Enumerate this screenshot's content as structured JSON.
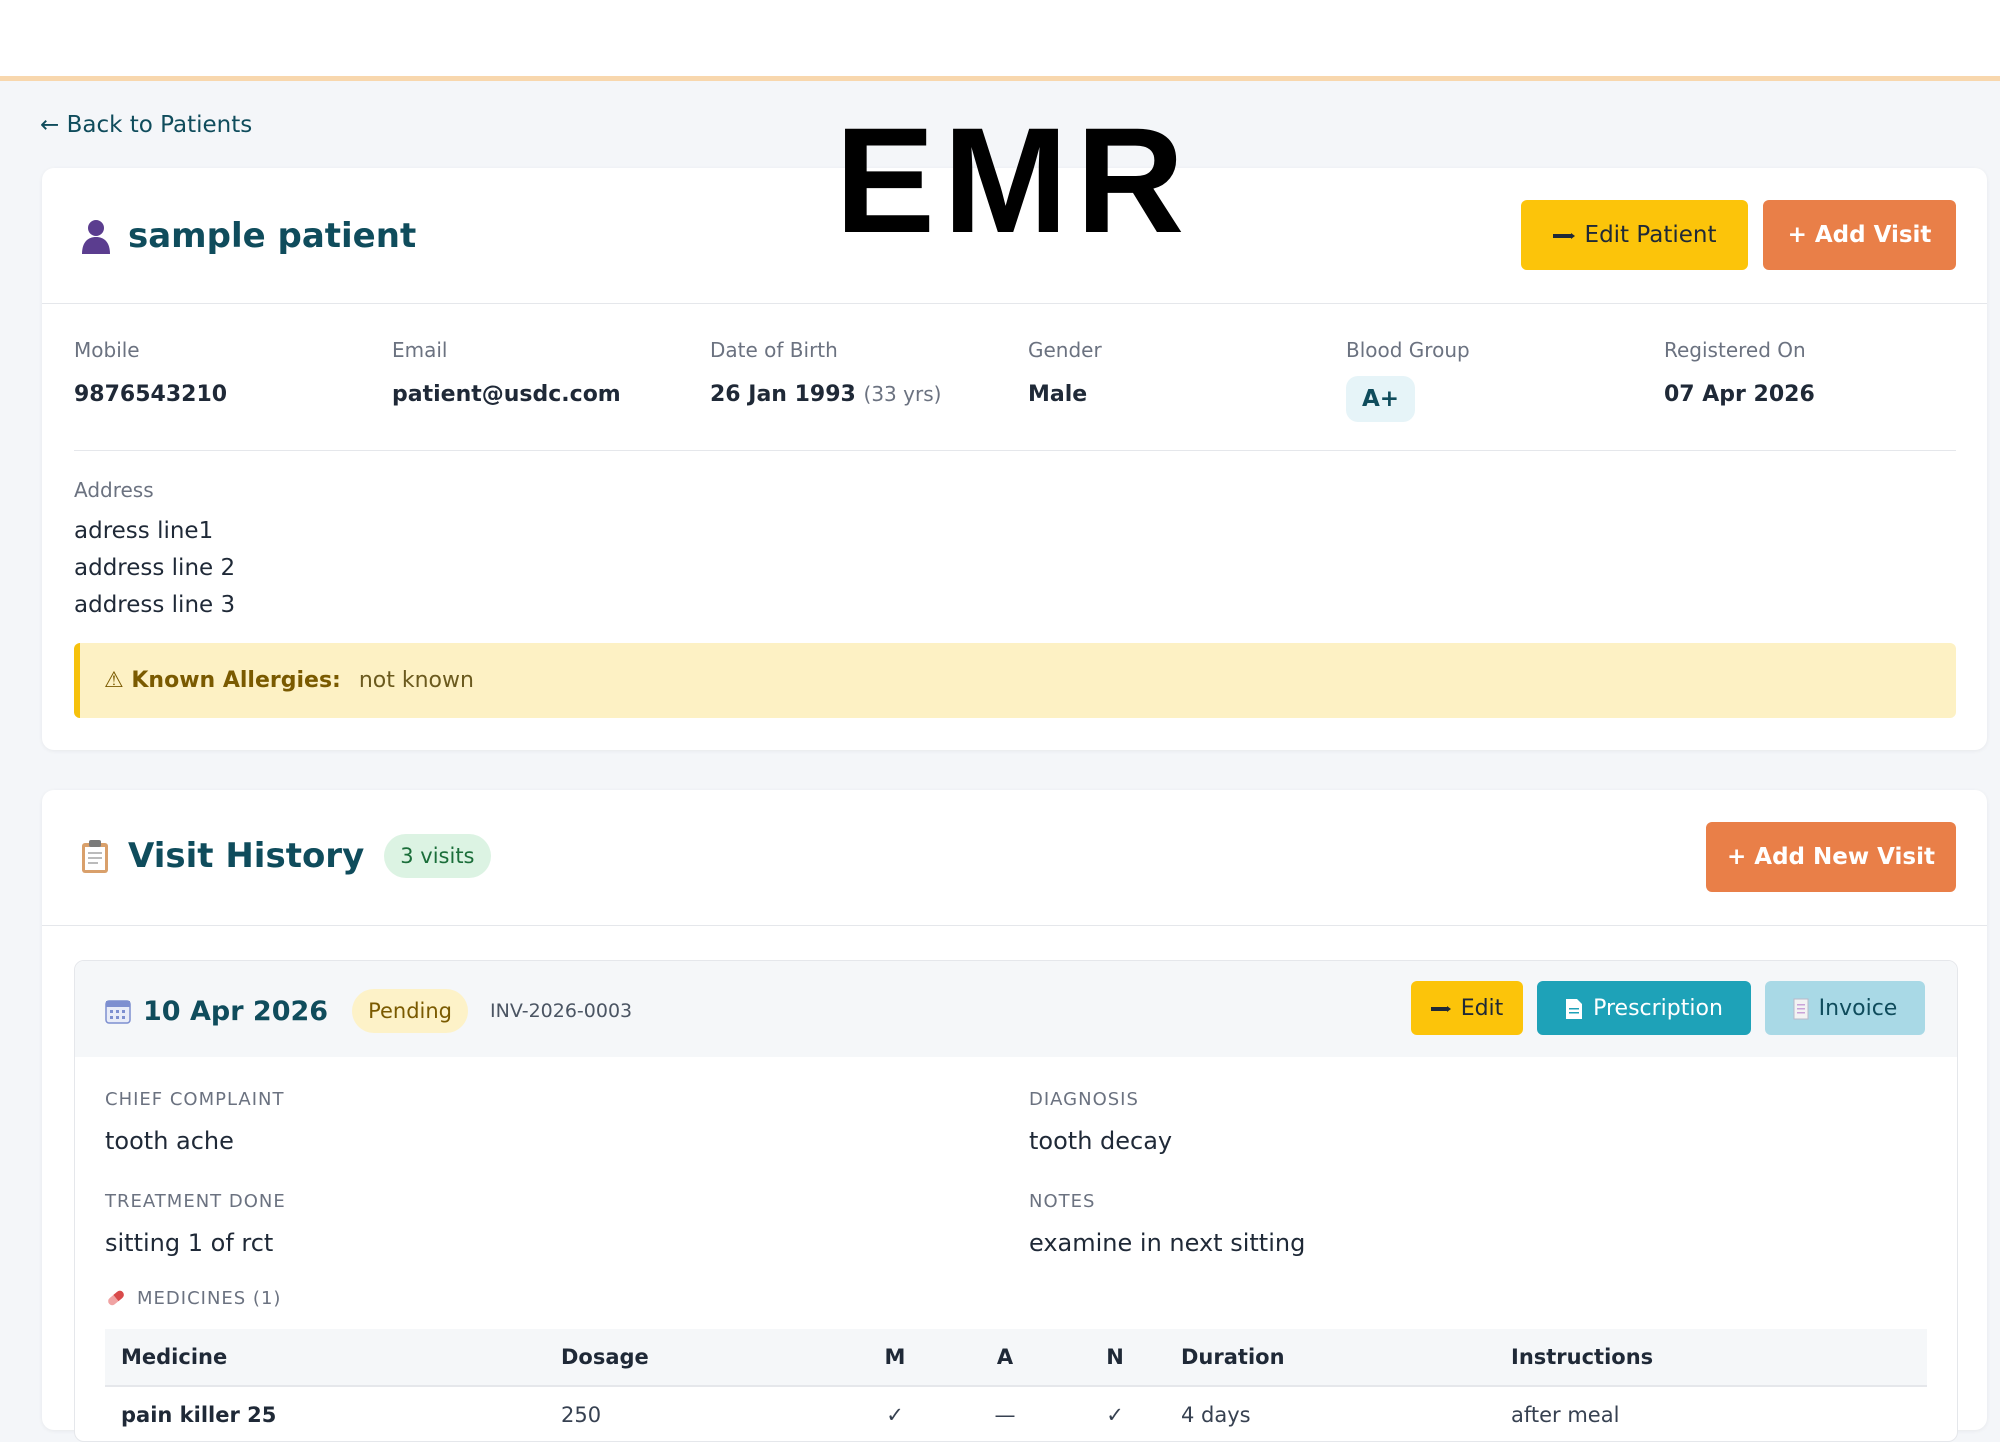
{
  "overlay_text": "EMR",
  "back_link": "← Back to Patients",
  "patient": {
    "name": "sample patient",
    "edit_button": "Edit Patient",
    "add_visit_button": "+ Add Visit",
    "fields": {
      "mobile_label": "Mobile",
      "mobile": "9876543210",
      "email_label": "Email",
      "email": "patient@usdc.com",
      "dob_label": "Date of Birth",
      "dob": "26 Jan 1993",
      "age": "(33 yrs)",
      "gender_label": "Gender",
      "gender": "Male",
      "blood_label": "Blood Group",
      "blood": "A+",
      "registered_label": "Registered On",
      "registered": "07 Apr 2026"
    },
    "address_label": "Address",
    "address_lines": [
      "adress line1",
      "address line 2",
      "address line 3"
    ],
    "allergy_label": "⚠ Known Allergies:",
    "allergy_value": "not known"
  },
  "visits": {
    "title": "Visit History",
    "count": "3 visits",
    "add_button": "+ Add New Visit",
    "items": [
      {
        "date": "10 Apr 2026",
        "status": "Pending",
        "invoice_no": "INV-2026-0003",
        "edit_label": "Edit",
        "rx_label": "Prescription",
        "invoice_label": "Invoice",
        "chief_complaint_label": "CHIEF COMPLAINT",
        "chief_complaint": "tooth ache",
        "diagnosis_label": "DIAGNOSIS",
        "diagnosis": "tooth decay",
        "treatment_label": "TREATMENT DONE",
        "treatment": "sitting 1 of rct",
        "notes_label": "NOTES",
        "notes": "examine in next sitting",
        "medicines_label": "MEDICINES (1)",
        "table_headers": [
          "Medicine",
          "Dosage",
          "M",
          "A",
          "N",
          "Duration",
          "Instructions"
        ],
        "medicines": [
          {
            "name": "pain killer 25",
            "dosage": "250",
            "m": "✓",
            "a": "—",
            "n": "✓",
            "duration": "4 days",
            "instructions": "after meal"
          }
        ]
      }
    ]
  },
  "colors": {
    "accent_orange": "#e97f48",
    "accent_yellow": "#fcc40a",
    "accent_teal": "#1ea2b8",
    "title_teal": "#0f4c5c"
  }
}
